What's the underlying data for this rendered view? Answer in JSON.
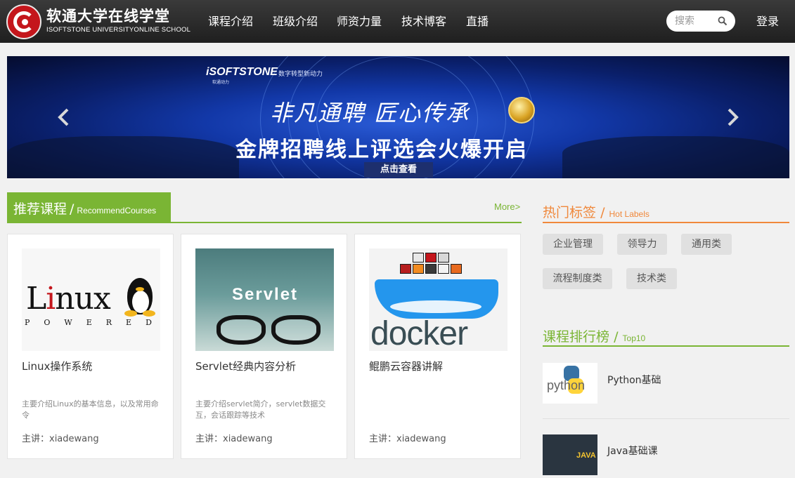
{
  "header": {
    "logo_title": "软通大学在线学堂",
    "logo_subtitle": "ISOFTSTONE UNIVERSITYONLINE SCHOOL",
    "nav": [
      "课程介绍",
      "班级介绍",
      "师资力量",
      "技术博客",
      "直播"
    ],
    "search_placeholder": "搜索",
    "login_label": "登录"
  },
  "banner": {
    "brand": "iSOFTSTONE",
    "brand_sub": "软通动力",
    "tagline": "数字转型新动力",
    "slogan": "非凡通聘 匠心传承",
    "headline": "金牌招聘线上评选会火爆开启",
    "cta": "点击查看"
  },
  "recommend": {
    "title_cn": "推荐课程",
    "separator": "/",
    "title_en": "RecommendCourses",
    "more": "More>"
  },
  "courses": [
    {
      "title": "Linux操作系统",
      "desc": "主要介绍Linux的基本信息，以及常用命令",
      "teacher": "主讲：xiadewang",
      "thumb_text": "Linux",
      "thumb_sub": "POWERED"
    },
    {
      "title": "Servlet经典内容分析",
      "desc": "主要介绍servlet简介，servlet数据交互，会话跟踪等技术",
      "teacher": "主讲：xiadewang",
      "thumb_text": "Servlet"
    },
    {
      "title": "鲲鹏云容器讲解",
      "desc": "",
      "teacher": "主讲：xiadewang",
      "thumb_text": "docker"
    }
  ],
  "hot_labels": {
    "title_cn": "热门标签",
    "separator": "/",
    "title_en": "Hot Labels",
    "tags": [
      "企业管理",
      "领导力",
      "通用类",
      "流程制度类",
      "技术类"
    ]
  },
  "top10": {
    "title_cn": "课程排行榜",
    "separator": "/",
    "title_en": "Top10",
    "items": [
      {
        "label": "Python基础",
        "thumb_text": "python"
      },
      {
        "label": "Java基础课",
        "thumb_text": "JAVA"
      }
    ]
  },
  "colors": {
    "header_bg": "#2b2b2b",
    "green_accent": "#7ab534",
    "orange_accent": "#f0883b",
    "logo_red": "#c4161c",
    "page_bg": "#f1f1f1"
  }
}
